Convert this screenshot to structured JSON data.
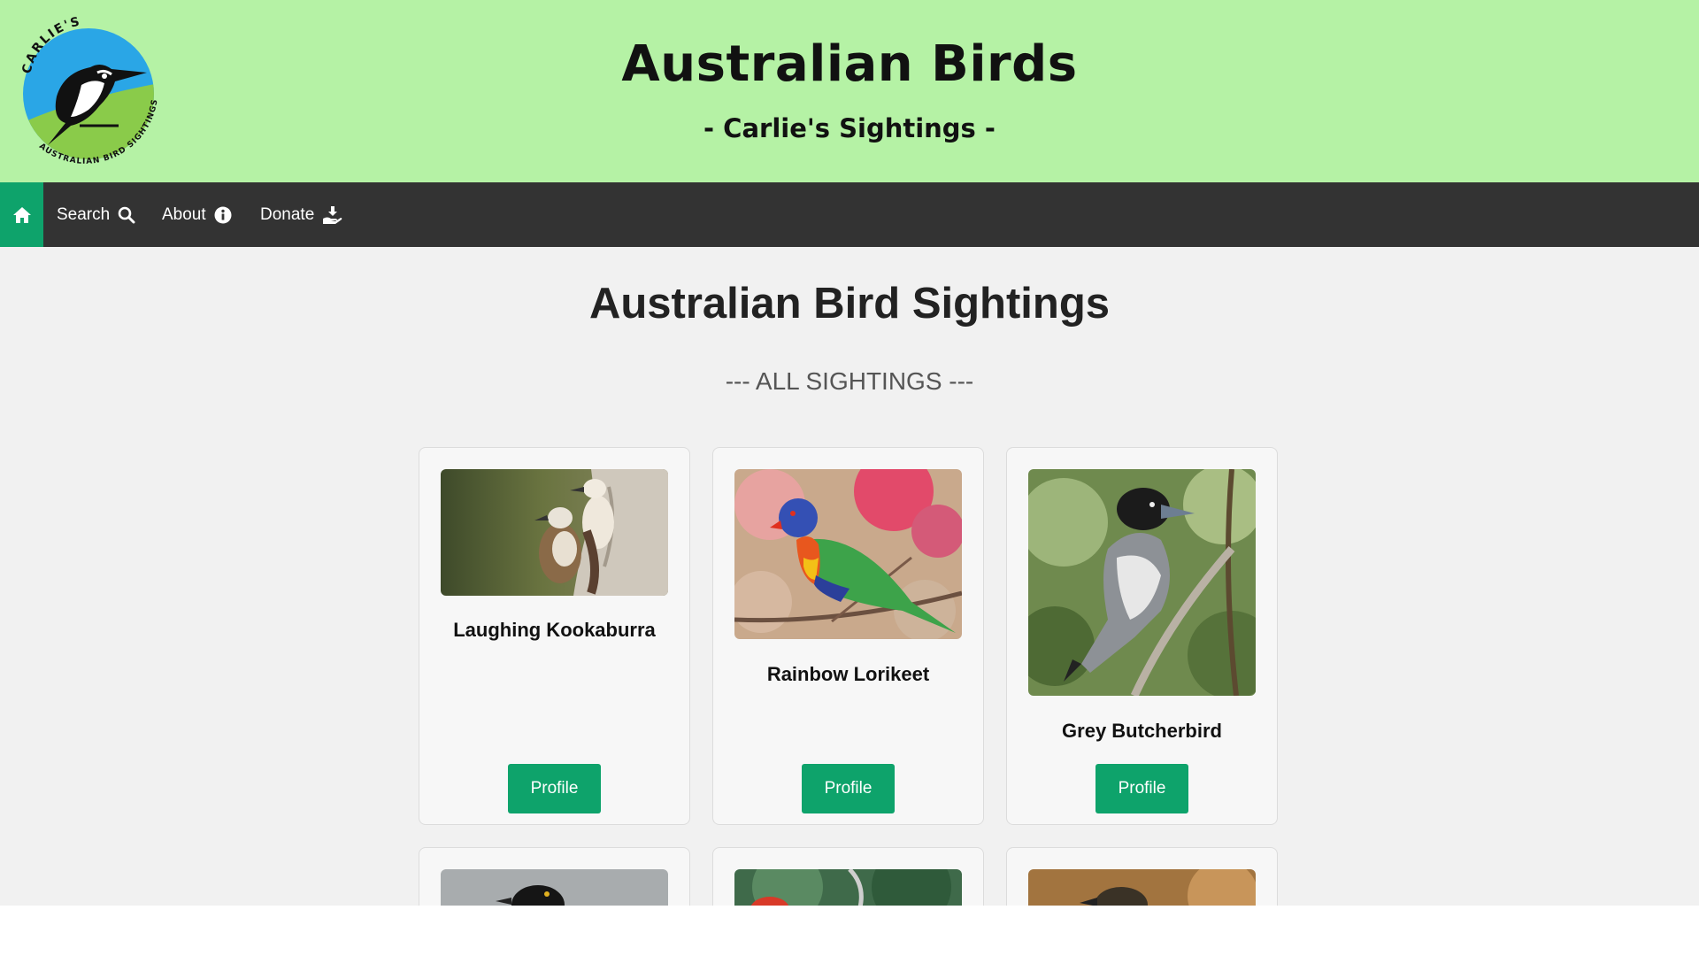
{
  "header": {
    "title": "Australian Birds",
    "subtitle": "- Carlie's Sightings -",
    "logo": {
      "top_text": "CARLIE'S",
      "ring_text": "AUSTRALIAN BIRD SIGHTINGS"
    }
  },
  "nav": {
    "home_icon": "home-icon",
    "items": [
      {
        "label": "Search",
        "icon": "search-icon"
      },
      {
        "label": "About",
        "icon": "info-icon"
      },
      {
        "label": "Donate",
        "icon": "donate-icon"
      }
    ]
  },
  "main": {
    "heading": "Australian Bird Sightings",
    "section_label": "--- ALL SIGHTINGS ---"
  },
  "cards": [
    {
      "name": "Laughing Kookaburra",
      "button": "Profile"
    },
    {
      "name": "Rainbow Lorikeet",
      "button": "Profile"
    },
    {
      "name": "Grey Butcherbird",
      "button": "Profile"
    }
  ],
  "colors": {
    "header_bg": "#b5f2a5",
    "nav_bg": "#333333",
    "accent": "#0ea36b",
    "page_bg": "#f1f1f1"
  }
}
